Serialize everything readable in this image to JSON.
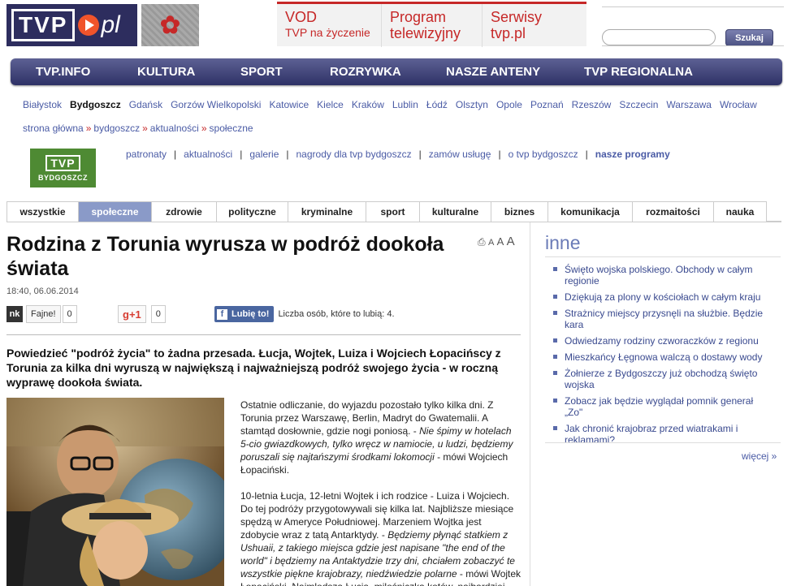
{
  "header": {
    "logo_tvp": "TVP",
    "logo_pl": "pl",
    "promos": [
      {
        "l1": "VOD",
        "l2": "TVP na życzenie"
      },
      {
        "l1": "Program",
        "l2": "telewizyjny"
      },
      {
        "l1": "Serwisy",
        "l2": "tvp.pl"
      }
    ],
    "search_placeholder": "",
    "search_button": "Szukaj"
  },
  "mainnav": [
    "TVP.INFO",
    "KULTURA",
    "SPORT",
    "ROZRYWKA",
    "NASZE ANTENY",
    "TVP REGIONALNA"
  ],
  "cities": [
    "Białystok",
    "Bydgoszcz",
    "Gdańsk",
    "Gorzów Wielkopolski",
    "Katowice",
    "Kielce",
    "Kraków",
    "Lublin",
    "Łódź",
    "Olsztyn",
    "Opole",
    "Poznań",
    "Rzeszów",
    "Szczecin",
    "Warszawa",
    "Wrocław"
  ],
  "current_city": "Bydgoszcz",
  "breadcrumb": [
    "strona główna",
    "bydgoszcz",
    "aktualności",
    "społeczne"
  ],
  "breadcrumb_sep": "»",
  "regional_logo": {
    "tvp": "TVP",
    "name": "BYDGOSZCZ"
  },
  "subnav": [
    "patronaty",
    "aktualności",
    "galerie",
    "nagrody dla tvp bydgoszcz",
    "zamów usługę",
    "o tvp bydgoszcz",
    "nasze programy"
  ],
  "subnav_sep": "|",
  "tabs": [
    "wszystkie",
    "społeczne",
    "zdrowie",
    "polityczne",
    "kryminalne",
    "sport",
    "kulturalne",
    "biznes",
    "komunikacja",
    "rozmaitości",
    "nauka"
  ],
  "active_tab": "społeczne",
  "article": {
    "title": "Rodzina z Torunia wyrusza w podróż dookoła świata",
    "date": "18:40, 06.06.2014",
    "tools": {
      "print_icon": "print-icon",
      "a1": "A",
      "a2": "A",
      "a3": "A"
    },
    "nk": {
      "icon": "nk",
      "label": "Fajne!",
      "count": "0"
    },
    "gplus": {
      "icon": "g+1",
      "count": "0"
    },
    "fb": {
      "icon": "f",
      "button": "Lubię to!",
      "text": "Liczba osób, które to lubią: 4."
    },
    "lead": "Powiedzieć \"podróż życia\" to żadna przesada. Łucja, Wojtek, Luiza i Wojciech Łopacińscy z Torunia za kilka dni wyruszą w największą i najważniejszą podróż swojego życia - w roczną wyprawę dookoła świata.",
    "p1_plain": "Ostatnie odliczanie, do wyjazdu pozostało tylko kilka dni. Z Torunia przez Warszawę, Berlin, Madryt do Gwatemalii. A stamtąd dosłownie, gdzie nogi poniosą. - ",
    "p1_italic": "Nie śpimy w hotelach 5-cio gwiazdkowych, tylko wręcz w namiocie, u ludzi, będziemy poruszali się najtańszymi środkami lokomocji",
    "p1_tail": " - mówi Wojciech Łopaciński.",
    "p2_plain": "10-letnia Łucja, 12-letni Wojtek i ich rodzice - Luiza i Wojciech. Do tej podróży przygotowywali się kilka lat. Najbliższe miesiące spędzą w Ameryce Południowej. Marzeniem Wojtka jest zdobycie wraz z tatą Antarktydy. - ",
    "p2_italic": "Będziemy płynąć statkiem z Ushuaii, z takiego miejsca gdzie jest napisane \"the end of the world\" i będziemy na Antaktydzie trzy dni, chciałem zobaczyć te wszystkie piękne krajobrazy, niedźwiedzie polarne",
    "p2_tail": " - mówi Wojtek Łopaciński. Najmłodsza Łucja, miłośniczka kotów, najbardziej"
  },
  "sidebar": {
    "title": "inne",
    "items": [
      "Święto wojska polskiego. Obchody w całym regionie",
      "Dziękują za plony w kościołach w całym kraju",
      "Strażnicy miejscy przysnęli na służbie. Będzie kara",
      "Odwiedzamy rodziny czworaczków z regionu",
      "Mieszkańcy Łęgnowa walczą o dostawy wody",
      "Żołnierze z Bydgoszczy już obchodzą święto wojska",
      "Zobacz jak będzie wyglądał pomnik generał „Zo\"",
      "Jak chronić krajobraz przed wiatrakami i reklamami?"
    ],
    "more": "więcej »"
  },
  "colors": {
    "nav": "#2e3166",
    "accent": "#c62828",
    "link": "#4a5ba5",
    "active_tab": "#8a9ac8",
    "regional_green": "#4e8a33"
  }
}
